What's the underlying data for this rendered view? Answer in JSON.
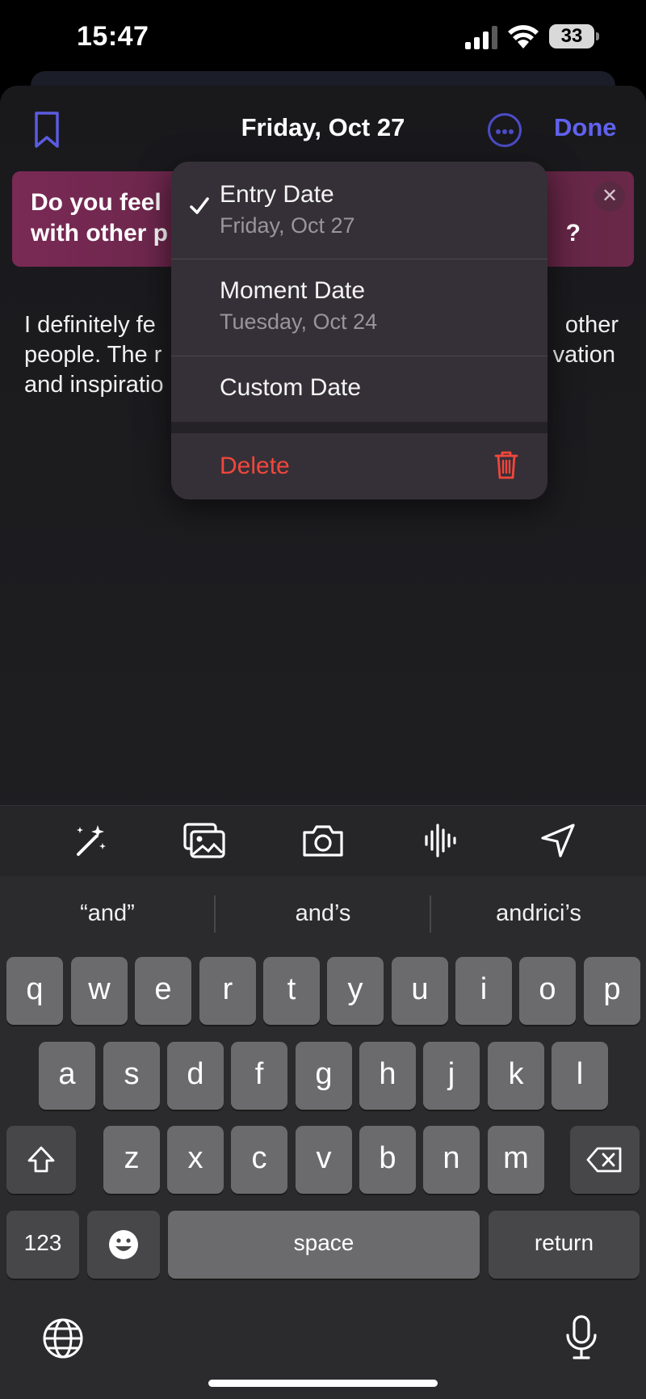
{
  "status_bar": {
    "time": "15:47",
    "battery": "33"
  },
  "header": {
    "title": "Friday, Oct 27",
    "done_label": "Done"
  },
  "prompt": {
    "line1": "Do you feel",
    "line2": "with other p",
    "line2_end": "?"
  },
  "entry_text": {
    "line1_start": "I definitely fe",
    "line1_end": "other",
    "line2_start": "people. The r",
    "line2_end": "vation",
    "line3_start": "and inspiratio"
  },
  "date_menu": {
    "items": [
      {
        "label": "Entry Date",
        "sublabel": "Friday, Oct 27",
        "selected": true
      },
      {
        "label": "Moment Date",
        "sublabel": "Tuesday, Oct 24",
        "selected": false
      },
      {
        "label": "Custom Date",
        "selected": false
      }
    ],
    "delete_label": "Delete",
    "delete_color": "#f2463c"
  },
  "toolbar": {
    "icons": [
      "magic-wand-icon",
      "photo-library-icon",
      "camera-icon",
      "audio-waveform-icon",
      "location-arrow-icon"
    ]
  },
  "keyboard": {
    "suggestions": [
      "“and”",
      "and’s",
      "andrici’s"
    ],
    "row1": [
      "q",
      "w",
      "e",
      "r",
      "t",
      "y",
      "u",
      "i",
      "o",
      "p"
    ],
    "row2": [
      "a",
      "s",
      "d",
      "f",
      "g",
      "h",
      "j",
      "k",
      "l"
    ],
    "row3": [
      "z",
      "x",
      "c",
      "v",
      "b",
      "n",
      "m"
    ],
    "numbers_label": "123",
    "space_label": "space",
    "return_label": "return"
  },
  "colors": {
    "accent": "#6062ee",
    "prompt_bg": "#6b2849",
    "destructive": "#f2463c"
  }
}
